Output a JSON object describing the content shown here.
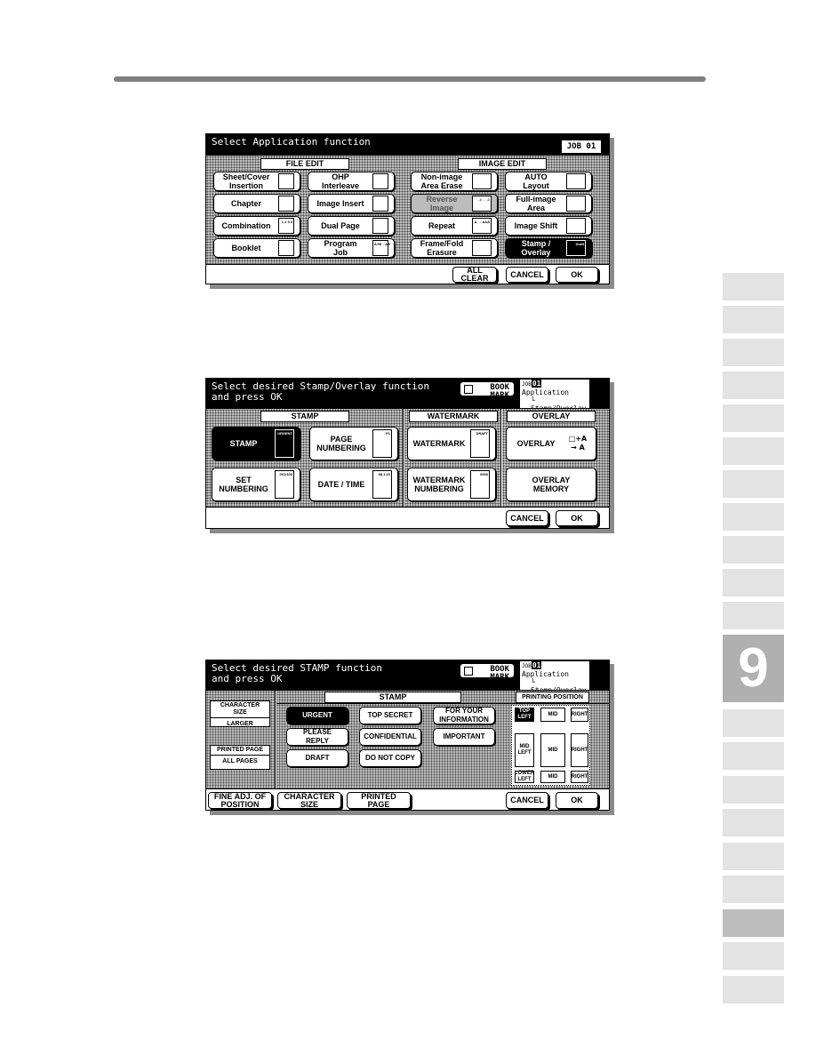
{
  "colors": {
    "rule": "#808080",
    "tab": "#e3e3e3",
    "tab_active": "#b0b0b0",
    "tab_mid": "#bdbdbd",
    "screen_bg": "#000000"
  },
  "side_tabs": {
    "active_label": "9"
  },
  "screen1": {
    "title": "Select Application function",
    "job_tab": "JOB 01",
    "file_edit_header": "FILE EDIT",
    "image_edit_header": "IMAGE EDIT",
    "file_edit_buttons": [
      {
        "label": "Sheet/Cover\nInsertion",
        "icon": "stacked-sheets-icon"
      },
      {
        "label": "OHP\nInterleave",
        "icon": "ohp-icon"
      },
      {
        "label": "Chapter",
        "icon": "chapter-icon"
      },
      {
        "label": "Image Insert",
        "icon": "image-insert-icon"
      },
      {
        "label": "Combination",
        "icon": "combination-grid-icon",
        "icon_text": "1 2 3 4"
      },
      {
        "label": "Dual Page",
        "icon": "dual-page-icon"
      },
      {
        "label": "Booklet",
        "icon": "booklet-icon"
      },
      {
        "label": "Program\nJob",
        "icon": "program-job-icon",
        "icon_text": "A+B→AB"
      }
    ],
    "image_edit_buttons": [
      {
        "label": "Non-image\nArea Erase",
        "icon": "area-erase-icon",
        "state": "normal"
      },
      {
        "label": "AUTO\nLayout",
        "icon": "auto-layout-icon",
        "state": "normal"
      },
      {
        "label": "Reverse\nImage",
        "icon": "reverse-image-icon",
        "icon_text": "A → A",
        "state": "disabled"
      },
      {
        "label": "Full-image\nArea",
        "icon": "full-image-icon",
        "state": "normal"
      },
      {
        "label": "Repeat",
        "icon": "repeat-icon",
        "icon_text": "A → AAA",
        "state": "normal"
      },
      {
        "label": "Image Shift",
        "icon": "image-shift-icon",
        "state": "normal"
      },
      {
        "label": "Frame/Fold\nErasure",
        "icon": "frame-fold-icon",
        "state": "normal"
      },
      {
        "label": "Stamp /\nOverlay",
        "icon": "draft-icon",
        "icon_text": "Draft",
        "state": "selected"
      }
    ],
    "buttons": {
      "all_clear": "ALL\nCLEAR",
      "cancel": "CANCEL",
      "ok": "OK"
    }
  },
  "screen2": {
    "title": "Select desired Stamp/Overlay function\nand press OK",
    "bookmark": "BOOK\nMARK",
    "crumb": {
      "job_prefix": "JOB",
      "job_no": "01",
      "line1": "Application",
      "line2": "└ Stamp/Overlay"
    },
    "headers": {
      "stamp": "STAMP",
      "watermark": "WATERMARK",
      "overlay": "OVERLAY"
    },
    "stamp_buttons": [
      {
        "label": "STAMP",
        "icon_text": "URGENT",
        "state": "selected"
      },
      {
        "label": "PAGE\nNUMBERING",
        "icon_text": "P1",
        "state": "normal"
      },
      {
        "label": "SET\nNUMBERING",
        "icon_text": "001/100",
        "state": "normal"
      },
      {
        "label": "DATE / TIME",
        "icon_text": "98.1.23",
        "state": "normal"
      }
    ],
    "watermark_buttons": [
      {
        "label": "WATERMARK",
        "icon_text": "DRAFT"
      },
      {
        "label": "WATERMARK\nNUMBERING",
        "icon_text": "0000"
      }
    ],
    "overlay_buttons": [
      {
        "label": "OVERLAY",
        "icon_text": "□+A → A"
      },
      {
        "label": "OVERLAY\nMEMORY",
        "icon_text": ""
      }
    ],
    "buttons": {
      "cancel": "CANCEL",
      "ok": "OK"
    }
  },
  "screen3": {
    "title": "Select desired STAMP function\nand press OK",
    "bookmark": "BOOK\nMARK",
    "crumb": {
      "job_prefix": "JOB",
      "job_no": "01",
      "line1": "Application",
      "line2": "└ Stamp/Overlay"
    },
    "character_size": {
      "title": "CHARACTER\nSIZE",
      "value": "LARGER"
    },
    "printed_page": {
      "title": "PRINTED PAGE",
      "value": "ALL PAGES"
    },
    "stamp_header": "STAMP",
    "printing_position_header": "PRINTING POSITION",
    "stamps": [
      {
        "label": "URGENT",
        "state": "selected"
      },
      {
        "label": "TOP SECRET",
        "state": "normal"
      },
      {
        "label": "FOR YOUR\nINFORMATION",
        "state": "normal"
      },
      {
        "label": "PLEASE\nREPLY",
        "state": "normal"
      },
      {
        "label": "CONFIDENTIAL",
        "state": "normal"
      },
      {
        "label": "IMPORTANT",
        "state": "normal"
      },
      {
        "label": "DRAFT",
        "state": "normal"
      },
      {
        "label": "DO NOT COPY",
        "state": "normal"
      }
    ],
    "positions": [
      {
        "label": "TOP\nLEFT",
        "state": "selected"
      },
      {
        "label": "MID",
        "state": "normal"
      },
      {
        "label": "RIGHT",
        "state": "normal"
      },
      {
        "label": "MID\nLEFT",
        "state": "normal"
      },
      {
        "label": "MID",
        "state": "normal"
      },
      {
        "label": "RIGHT",
        "state": "normal"
      },
      {
        "label": "LOWER\nLEFT",
        "state": "normal"
      },
      {
        "label": "MID",
        "state": "normal"
      },
      {
        "label": "RIGHT",
        "state": "normal"
      }
    ],
    "buttons": {
      "fine_adj": "FINE ADJ. OF\nPOSITION",
      "character_size": "CHARACTER\nSIZE",
      "printed_page": "PRINTED\nPAGE",
      "cancel": "CANCEL",
      "ok": "OK"
    }
  }
}
